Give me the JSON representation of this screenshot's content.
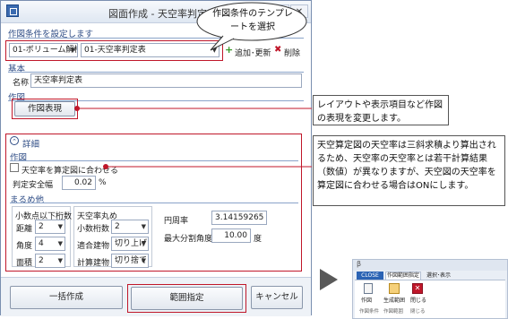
{
  "window": {
    "title": "図面作成 - 天空率判定表"
  },
  "template_section": {
    "header": "作図条件を設定します",
    "category_value": "01-ボリューム解析",
    "template_value": "01-天空率判定表",
    "add_update_label": "追加･更新",
    "delete_label": "削除"
  },
  "basic_section": {
    "header": "基本",
    "name_label": "名称",
    "name_value": "天空率判定表"
  },
  "drawing_section": {
    "header": "作図",
    "expression_button": "作図表現"
  },
  "details": {
    "toggle_label": "詳細",
    "sakuzu_header": "作図",
    "checkbox_label": "天空率を算定図に合わせる",
    "safety_label": "判定安全幅",
    "safety_value": "0.02",
    "safety_unit": "%"
  },
  "rounding": {
    "header": "まるめ他",
    "decimal_group_title": "小数点以下桁数",
    "rows": [
      {
        "label": "距離",
        "value": "2"
      },
      {
        "label": "角度",
        "value": "4"
      },
      {
        "label": "面積",
        "value": "2"
      }
    ],
    "sky_group_title": "天空率丸め",
    "sky_rows": [
      {
        "label": "小数桁数",
        "value": "2"
      },
      {
        "label": "適合建物",
        "value": "切り上げ"
      },
      {
        "label": "計算建物",
        "value": "切り捨て"
      }
    ],
    "pi_label": "円周率",
    "pi_value": "3.14159265",
    "max_angle_label": "最大分割角度",
    "max_angle_value": "10.00",
    "max_angle_unit": "度"
  },
  "footer": {
    "batch_button": "一括作成",
    "range_button": "範囲指定",
    "cancel_button": "キャンセル"
  },
  "callouts": {
    "template_bubble": "作図条件のテンプレートを選択",
    "expression_note": "レイアウトや表示項目など作図の表現を変更します。",
    "sky_note": "天空算定図の天空率は三斜求積より算出されるため、天空率の天空率とは若干計算結果（数値）が異なりますが、天空図の天空率を算定図に合わせる場合はONにします。"
  },
  "ribbon": {
    "app_mark": "β",
    "tabs": [
      "CLOSE",
      "作図範囲指定",
      "選択･表示"
    ],
    "buttons": [
      "作図",
      "生成範囲",
      "閉じる"
    ],
    "groups": [
      "作図条件",
      "作図範囲",
      "閉じる"
    ]
  },
  "colors": {
    "highlight": "#c0172a",
    "accent_blue": "#2f4d86",
    "ribbon_tab_active": "#2b63b4"
  }
}
